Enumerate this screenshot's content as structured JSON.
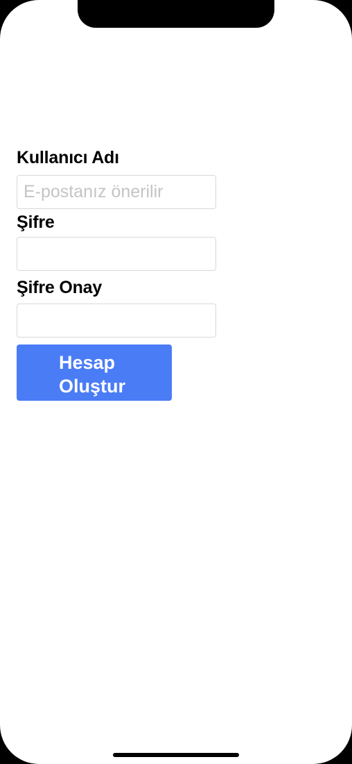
{
  "form": {
    "username_label": "Kullanıcı Adı",
    "username_placeholder": "E-postanız önerilir",
    "username_value": "",
    "password_label": "Şifre",
    "password_value": "",
    "password_confirm_label": "Şifre Onay",
    "password_confirm_value": "",
    "submit_label": "Hesap Oluştur"
  },
  "colors": {
    "button_background": "#4a7cf6",
    "button_text": "#ffffff",
    "placeholder_text": "#c4c4c4",
    "field_border": "#d8d8d8"
  }
}
